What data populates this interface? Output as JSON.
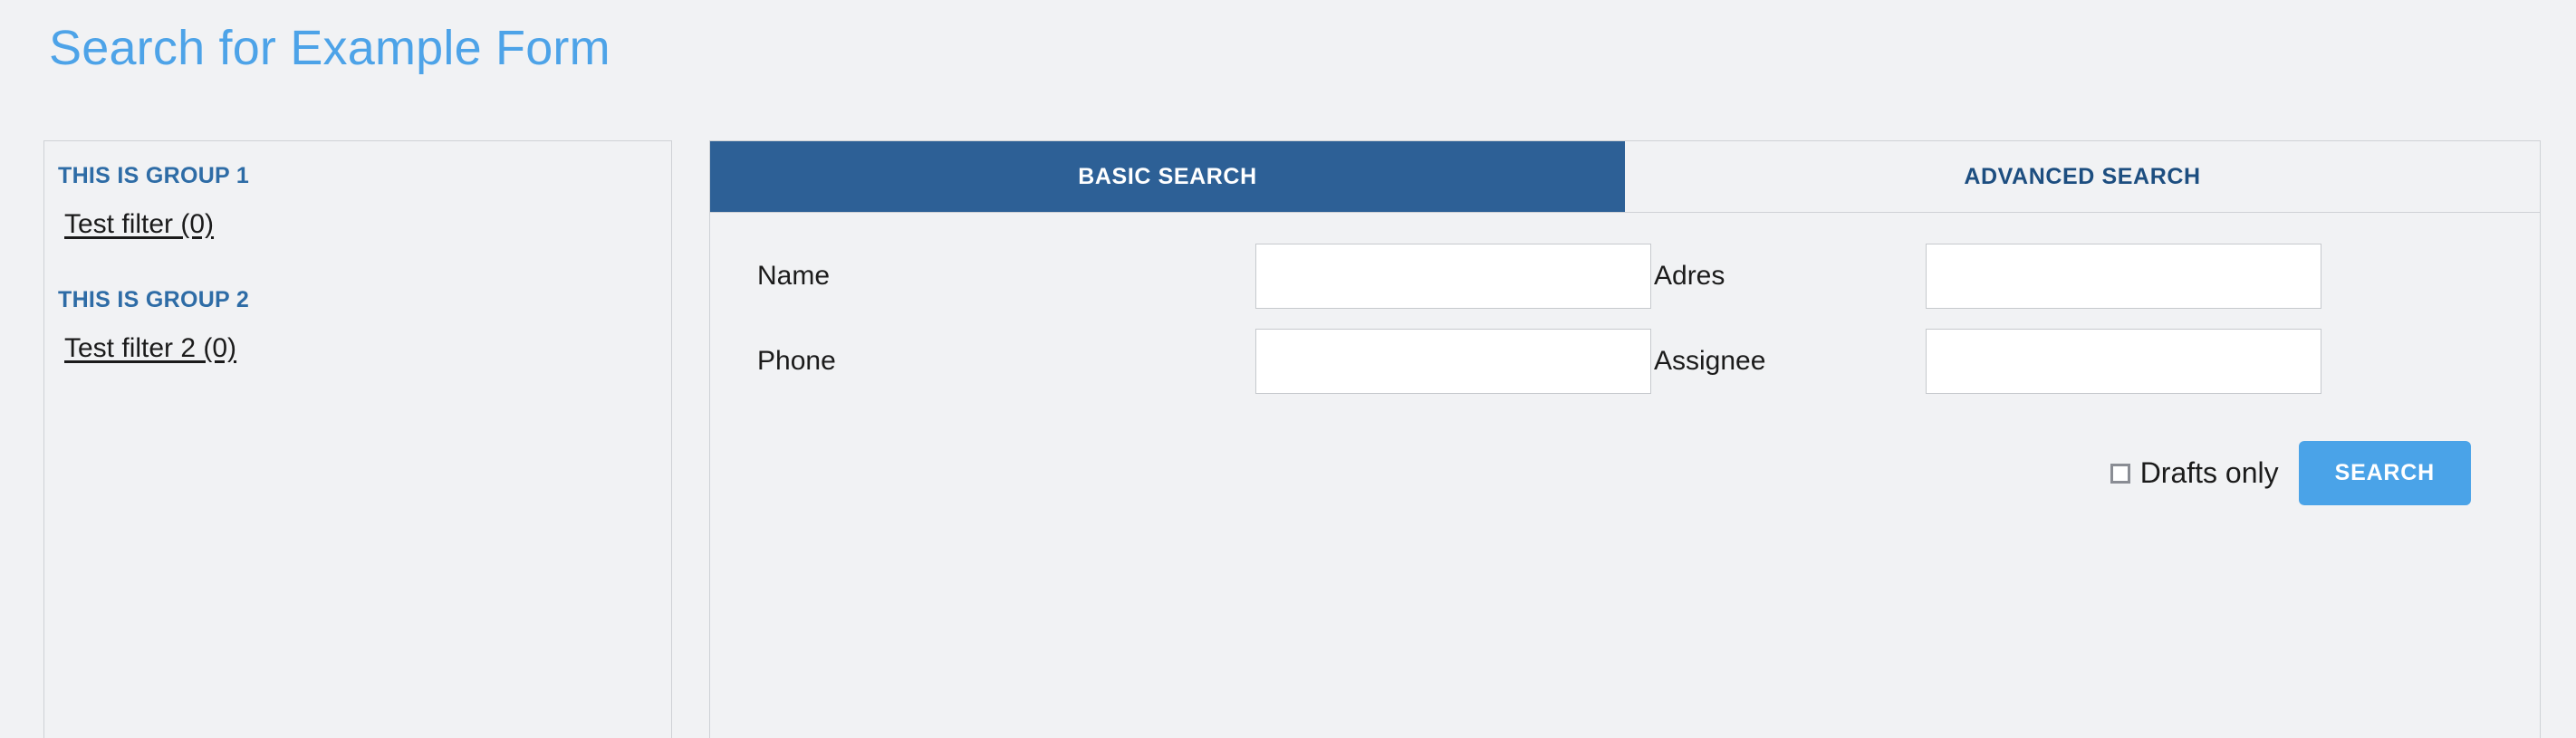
{
  "page": {
    "title": "Search for Example Form",
    "title_color": "#4da3e8",
    "background_color": "#f1f2f4"
  },
  "sidebar": {
    "groups": [
      {
        "heading": "THIS IS GROUP 1",
        "filters": [
          {
            "label": "Test filter (0)"
          }
        ]
      },
      {
        "heading": "THIS IS GROUP 2",
        "filters": [
          {
            "label": "Test filter 2 (0)"
          }
        ]
      }
    ],
    "heading_color": "#2e6ca6"
  },
  "tabs": [
    {
      "label": "BASIC SEARCH",
      "active": true,
      "active_bg": "#2d6096",
      "active_fg": "#ffffff"
    },
    {
      "label": "ADVANCED SEARCH",
      "active": false,
      "inactive_bg": "#f1f2f4",
      "inactive_fg": "#1d4e80"
    }
  ],
  "form": {
    "fields": [
      {
        "label": "Name",
        "value": "",
        "placeholder": ""
      },
      {
        "label": "Adres",
        "value": "",
        "placeholder": ""
      },
      {
        "label": "Phone",
        "value": "",
        "placeholder": ""
      },
      {
        "label": "Assignee",
        "value": "",
        "placeholder": ""
      }
    ]
  },
  "actions": {
    "drafts_only_label": "Drafts only",
    "drafts_only_checked": false,
    "search_label": "SEARCH",
    "search_button_color": "#4aa3e8"
  }
}
